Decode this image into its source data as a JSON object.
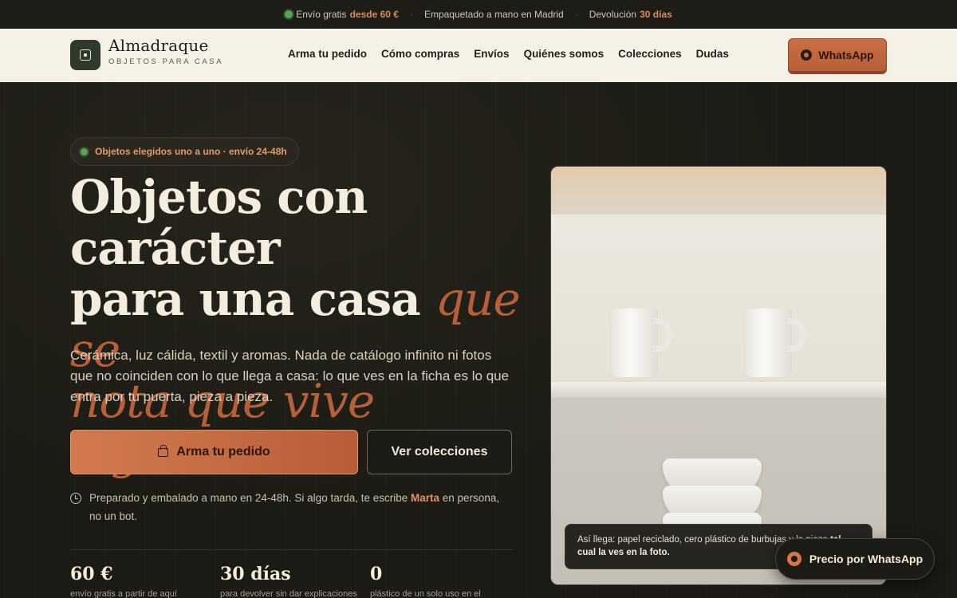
{
  "topbar": {
    "shipping_prefix": "Envío gratis",
    "shipping_highlight": "desde 60 €",
    "packed": "Empaquetado a mano en Madrid",
    "returns_prefix": "Devolución",
    "returns_highlight": "30 días",
    "separator": "·"
  },
  "header": {
    "brand_name": "Almadraque",
    "brand_tagline": "OBJETOS PARA CASA",
    "nav": [
      "Arma tu pedido",
      "Cómo compras",
      "Envíos",
      "Quiénes somos",
      "Colecciones",
      "Dudas"
    ],
    "whatsapp_label": "WhatsApp"
  },
  "hero": {
    "pill_text": "Objetos elegidos uno a uno · envío 24-48h",
    "headline_line1": "Objetos con carácter",
    "headline_line2_plain": "para una casa ",
    "headline_line2_accent": "que se",
    "headline_line3_accent": "nota que vive alguien",
    "headline_period": ".",
    "lead": "Cerámica, luz cálida, textil y aromas. Nada de catálogo infinito ni fotos que no coinciden con lo que llega a casa: lo que ves en la ficha es lo que entra por tu puerta, pieza a pieza.",
    "primary_button": "Arma tu pedido",
    "secondary_button": "Ver colecciones",
    "note_before": "Preparado y embalado a mano en 24-48h. Si algo tarda, te escribe ",
    "note_name": "Marta",
    "note_after": " en persona, no un bot."
  },
  "stats": [
    {
      "value": "60 €",
      "label": "envío gratis a partir de aquí"
    },
    {
      "value": "30 días",
      "label": "para devolver sin dar explicaciones"
    },
    {
      "value": "0",
      "label": "plástico de un solo uso en el"
    }
  ],
  "photo": {
    "caption_plain": "Así llega: papel reciclado, cero plástico de burbujas y la pieza ",
    "caption_bold": "tal cual la ves en la foto."
  },
  "floating": {
    "whatsapp_price": "Precio por WhatsApp"
  },
  "colors": {
    "accent": "#b6603a",
    "background": "#1b1a14",
    "header_bg": "#f6f1e6",
    "status_green": "#58a356"
  }
}
